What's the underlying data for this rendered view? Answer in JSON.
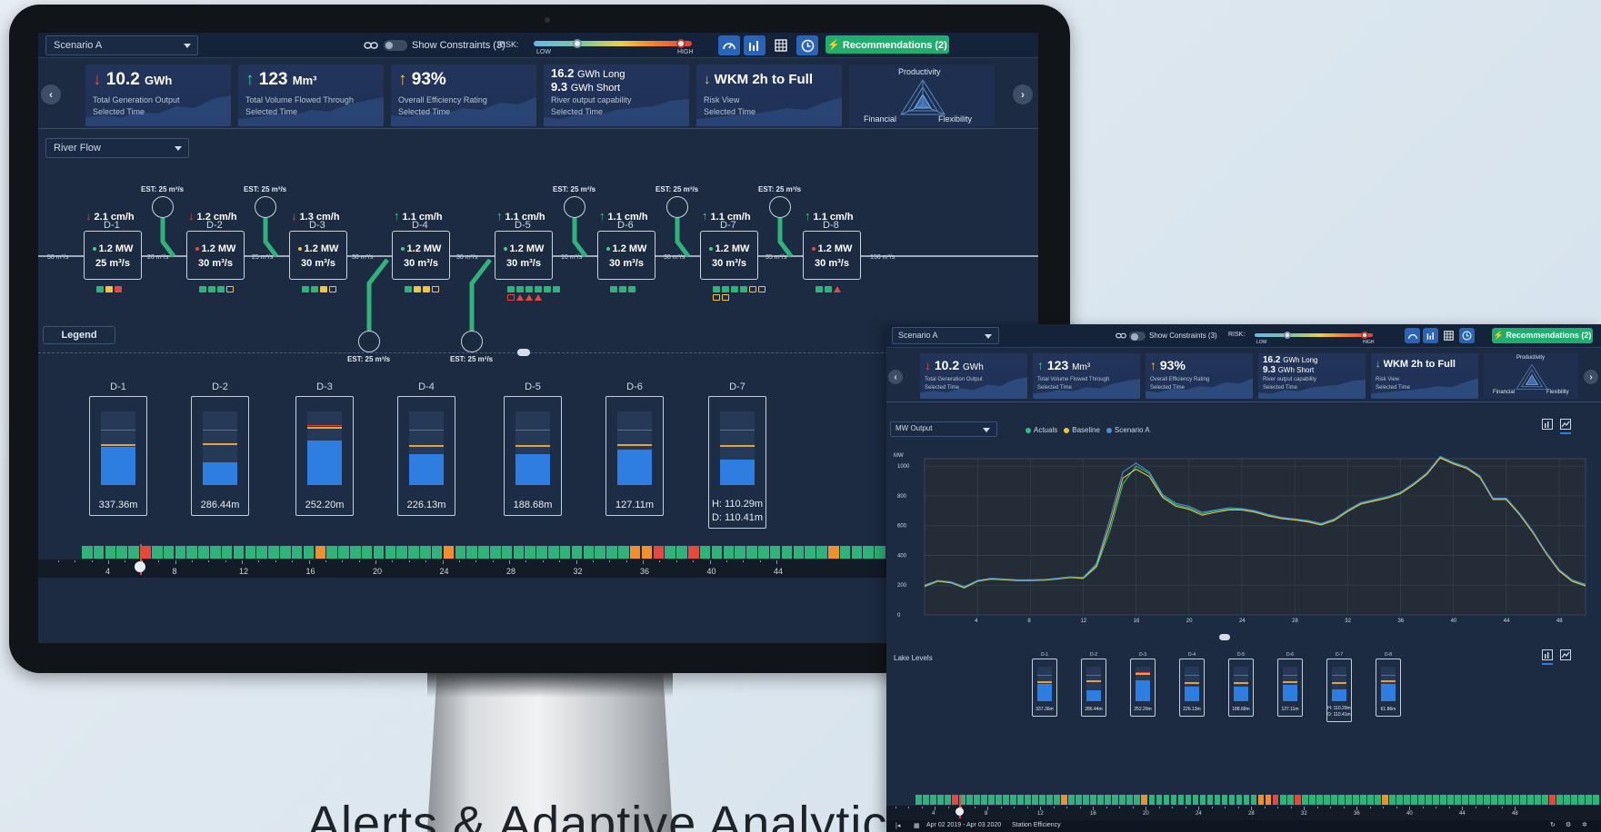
{
  "headline": "Alerts & Adaptive Analytics",
  "colors": {
    "bg_panel": "#1c2b42",
    "kpi": "#22345a",
    "accent": "#2e7de0",
    "green": "#1fae6e",
    "red": "#e8473e",
    "orange": "#ef8f2e",
    "yellow": "#f0c341"
  },
  "toolbar": {
    "scenario": "Scenario A",
    "link_icon": "link-icon",
    "show_constraints": "Show Constraints (3)",
    "risk_label": "RISK:",
    "risk_low": "LOW",
    "risk_high": "HIGH",
    "risk_low_value": 0.28,
    "risk_high_value": 0.87,
    "icons": [
      "gauge-icon",
      "bar-chart-icon",
      "grid-icon",
      "clock-icon"
    ],
    "recommendations": "⚡ Recommendations (2)"
  },
  "kpis": [
    {
      "arrow": "↓",
      "dir": "down",
      "value": "10.2",
      "unit": "GWh",
      "label1": "Total Generation Output",
      "label2": "Selected Time"
    },
    {
      "arrow": "↑",
      "dir": "up",
      "value": "123",
      "unit": "Mm³",
      "label1": "Total Volume Flowed Through",
      "label2": "Selected Time"
    },
    {
      "arrow": "↑",
      "dir": "warn",
      "value": "93%",
      "unit": "",
      "label1": "Overall Efficiency Rating",
      "label2": "Selected Time"
    },
    {
      "line_a": "16.2",
      "unit_a": "GWh Long",
      "line_b": "9.3",
      "unit_b": "GWh Short",
      "label1": "River output capability",
      "label2": "Selected Time"
    },
    {
      "arrow": "↓",
      "dir": "warn",
      "value": "WKM 2h to Full",
      "unit": "",
      "label1": "Risk View",
      "label2": "Selected Time"
    }
  ],
  "radar": {
    "title": "Productivity",
    "left": "Financial",
    "right": "Flexibility"
  },
  "river_view": "River Flow",
  "dams": [
    {
      "id": "D-1",
      "flow": "2.1 cm/h",
      "dir": "down",
      "mw": "1.2 MW",
      "vol": "25 m³/s",
      "dot": "#3ecf8e",
      "squares": [
        "#2fb37a",
        "#f0c341",
        "#e8473e"
      ]
    },
    {
      "id": "D-2",
      "flow": "1.2 cm/h",
      "dir": "down",
      "mw": "1.2 MW",
      "vol": "30 m³/s",
      "dot": "#e8473e",
      "squares": [
        "#2fb37a",
        "#2fb37a",
        "#2fb37a",
        "outline-o"
      ]
    },
    {
      "id": "D-3",
      "flow": "1.3 cm/h",
      "dir": "down",
      "mw": "1.2 MW",
      "vol": "30 m³/s",
      "dot": "#f0c341",
      "squares": [
        "#2fb37a",
        "#2fb37a",
        "#f0c341",
        "outline-o"
      ]
    },
    {
      "id": "D-4",
      "flow": "1.1 cm/h",
      "dir": "up",
      "mw": "1.2 MW",
      "vol": "30 m³/s",
      "dot": "#3ecf8e",
      "squares": [
        "#2fb37a",
        "#f0c341",
        "#f0c341",
        "outline-o"
      ]
    },
    {
      "id": "D-5",
      "flow": "1.1 cm/h",
      "dir": "up",
      "mw": "1.2 MW",
      "vol": "30 m³/s",
      "dot": "#3ecf8e",
      "squares": [
        "#2fb37a",
        "#2fb37a",
        "#2fb37a",
        "#2fb37a",
        "#2fb37a",
        "#2fb37a",
        "outline-r",
        "tri",
        "tri",
        "tri"
      ]
    },
    {
      "id": "D-6",
      "flow": "1.1 cm/h",
      "dir": "up",
      "mw": "1.2 MW",
      "vol": "30 m³/s",
      "dot": "#3ecf8e",
      "squares": [
        "#2fb37a",
        "#2fb37a",
        "#2fb37a"
      ]
    },
    {
      "id": "D-7",
      "flow": "1.1 cm/h",
      "dir": "up",
      "mw": "1.2 MW",
      "vol": "30 m³/s",
      "dot": "#3ecf8e",
      "squares": [
        "#2fb37a",
        "#2fb37a",
        "#2fb37a",
        "#2fb37a",
        "outline-o",
        "outline-o",
        "outline-o",
        "outline-o"
      ]
    },
    {
      "id": "D-8",
      "flow": "1.1 cm/h",
      "dir": "up",
      "mw": "1.2 MW",
      "vol": "30 m³/s",
      "dot": "#e8473e",
      "squares": [
        "#2fb37a",
        "#2fb37a",
        "tri"
      ]
    }
  ],
  "segment_rates": [
    "50 m³/s",
    "20 m³/s",
    "25 m³/s",
    "30 m³/s",
    "30 m³/s",
    "10 m³/s",
    "30 m³/s",
    "35 m³/s",
    "150 m³/s"
  ],
  "est_label": "EST: 25 m³/s",
  "legend_button": "Legend",
  "lakes": [
    {
      "id": "D-1",
      "level": "337.36m",
      "fill": 0.51,
      "red": 0.74,
      "orange": 0.53
    },
    {
      "id": "D-2",
      "level": "286.44m",
      "fill": 0.31,
      "red": 0.74,
      "orange": 0.54
    },
    {
      "id": "D-3",
      "level": "252.20m",
      "fill": 0.6,
      "red": 0.8,
      "orange": 0.76
    },
    {
      "id": "D-4",
      "level": "226.13m",
      "fill": 0.42,
      "red": 0.74,
      "orange": 0.51
    },
    {
      "id": "D-5",
      "level": "188.68m",
      "fill": 0.42,
      "red": 0.74,
      "orange": 0.51
    },
    {
      "id": "D-6",
      "level": "127.11m",
      "fill": 0.48,
      "red": 0.74,
      "orange": 0.53
    },
    {
      "id": "D-7",
      "level": "H: 110.29m",
      "level2": "D: 110.41m",
      "fill": 0.34,
      "red": 0.74,
      "orange": 0.51
    }
  ],
  "timeline": {
    "cells": [
      "g",
      "g",
      "g",
      "g",
      "g",
      "r",
      "g",
      "g",
      "g",
      "g",
      "g",
      "g",
      "g",
      "g",
      "g",
      "g",
      "g",
      "g",
      "g",
      "g",
      "o",
      "g",
      "g",
      "g",
      "g",
      "g",
      "g",
      "g",
      "g",
      "g",
      "g",
      "o",
      "g",
      "g",
      "g",
      "g",
      "g",
      "g",
      "g",
      "g",
      "g",
      "g",
      "g",
      "g",
      "g",
      "g",
      "g",
      "o",
      "o",
      "r",
      "g",
      "g",
      "r",
      "g",
      "g",
      "g",
      "g",
      "g",
      "g",
      "g",
      "g",
      "g",
      "g",
      "g",
      "o",
      "g",
      "g",
      "g",
      "g",
      "g",
      "g",
      "g",
      "g",
      "g",
      "g",
      "g",
      "g",
      "g",
      "g",
      "g",
      "g",
      "g"
    ],
    "ticks": [
      "4",
      "8",
      "12",
      "16",
      "20",
      "24",
      "28",
      "32",
      "36",
      "40",
      "44"
    ],
    "position": 0.09
  },
  "second": {
    "scenario": "Scenario A",
    "show_constraints": "Show Constraints (3)",
    "risk_label": "RISK:",
    "risk_low": "LOW",
    "risk_high": "HIGH",
    "recommendations": "⚡ Recommendations (2)",
    "metric": "MW Output",
    "legend": [
      {
        "name": "Actuals",
        "color": "#2fbf7f"
      },
      {
        "name": "Baseline",
        "color": "#e8c441"
      },
      {
        "name": "Scenario A",
        "color": "#4b8fd6"
      }
    ],
    "lake_title": "Lake Levels",
    "date_range": "Apr 02 2019 - Apr 03 2020",
    "efficiency_label": "Station Efficiency",
    "lakes": [
      {
        "id": "D-1",
        "level": "337.36m",
        "fill": 0.51,
        "red": 0.74,
        "orange": 0.53
      },
      {
        "id": "D-2",
        "level": "286.44m",
        "fill": 0.31,
        "red": 0.74,
        "orange": 0.54
      },
      {
        "id": "D-3",
        "level": "252.20m",
        "fill": 0.6,
        "red": 0.8,
        "orange": 0.76
      },
      {
        "id": "D-4",
        "level": "226.13m",
        "fill": 0.42,
        "red": 0.74,
        "orange": 0.51
      },
      {
        "id": "D-5",
        "level": "188.68m",
        "fill": 0.42,
        "red": 0.74,
        "orange": 0.51
      },
      {
        "id": "D-6",
        "level": "127.11m",
        "fill": 0.48,
        "red": 0.74,
        "orange": 0.53
      },
      {
        "id": "D-7",
        "level": "H: 110.29m",
        "level2": "D: 110.41m",
        "fill": 0.34,
        "red": 0.74,
        "orange": 0.51
      },
      {
        "id": "D-8",
        "level": "61.86m",
        "fill": 0.5,
        "red": 0.74,
        "orange": 0.55
      }
    ],
    "ticks": [
      "4",
      "8",
      "12",
      "16",
      "20",
      "24",
      "28",
      "32",
      "36",
      "40",
      "44",
      "48"
    ]
  },
  "chart_data": {
    "type": "line",
    "title": "",
    "xlabel": "",
    "ylabel": "MW",
    "xlim": [
      0,
      50
    ],
    "ylim": [
      0,
      1050
    ],
    "xticks": [
      4,
      8,
      12,
      16,
      20,
      24,
      28,
      32,
      36,
      40,
      44,
      48
    ],
    "yticks": [
      0,
      200,
      400,
      600,
      800,
      1000
    ],
    "grid": true,
    "legend_position": "top",
    "x": [
      0,
      1,
      2,
      3,
      4,
      5,
      6,
      7,
      8,
      9,
      10,
      11,
      12,
      13,
      14,
      15,
      16,
      17,
      18,
      19,
      20,
      21,
      22,
      23,
      24,
      25,
      26,
      27,
      28,
      29,
      30,
      31,
      32,
      33,
      34,
      35,
      36,
      37,
      38,
      39,
      40,
      41,
      42,
      43,
      44,
      45,
      46,
      47,
      48,
      49,
      50
    ],
    "series": [
      {
        "name": "Actuals",
        "values": [
          190,
          225,
          215,
          180,
          225,
          240,
          235,
          230,
          230,
          232,
          240,
          250,
          245,
          320,
          560,
          880,
          1000,
          950,
          800,
          740,
          720,
          680,
          700,
          710,
          710,
          695,
          670,
          650,
          640,
          630,
          610,
          640,
          700,
          750,
          770,
          790,
          820,
          880,
          950,
          1060,
          1020,
          990,
          930,
          780,
          780,
          680,
          560,
          420,
          300,
          230,
          200
        ]
      },
      {
        "name": "Baseline",
        "values": [
          195,
          228,
          218,
          185,
          228,
          242,
          238,
          232,
          233,
          235,
          243,
          252,
          248,
          330,
          600,
          920,
          980,
          930,
          790,
          730,
          710,
          670,
          690,
          705,
          705,
          690,
          665,
          648,
          638,
          625,
          605,
          635,
          695,
          745,
          765,
          785,
          815,
          875,
          945,
          1055,
          1015,
          985,
          925,
          775,
          775,
          675,
          555,
          415,
          295,
          225,
          195
        ]
      },
      {
        "name": "Scenario A",
        "values": [
          200,
          232,
          222,
          190,
          232,
          246,
          242,
          236,
          236,
          238,
          246,
          256,
          252,
          345,
          640,
          960,
          1020,
          960,
          810,
          750,
          730,
          690,
          705,
          720,
          715,
          700,
          675,
          655,
          645,
          635,
          615,
          645,
          705,
          755,
          775,
          795,
          825,
          885,
          955,
          1065,
          1025,
          995,
          935,
          785,
          785,
          685,
          565,
          425,
          305,
          235,
          205
        ]
      }
    ]
  }
}
